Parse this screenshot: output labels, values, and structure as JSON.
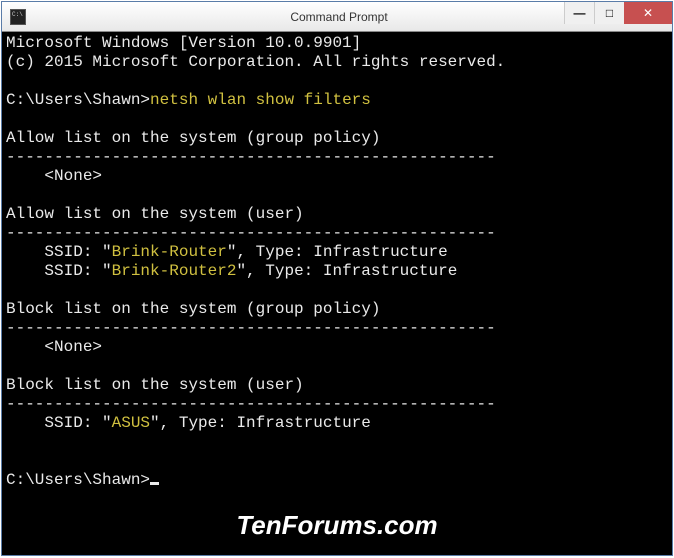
{
  "window": {
    "title": "Command Prompt",
    "min": "—",
    "max": "□",
    "close": "✕"
  },
  "terminal": {
    "line1": "Microsoft Windows [Version 10.0.9901]",
    "line2": "(c) 2015 Microsoft Corporation. All rights reserved.",
    "prompt1": "C:\\Users\\Shawn>",
    "command1": "netsh wlan show filters",
    "section1_title": "Allow list on the system (group policy)",
    "divider": "---------------------------------------------------",
    "none": "    <None>",
    "section2_title": "Allow list on the system (user)",
    "ssid_prefix": "    SSID: \"",
    "ssid1": "Brink-Router",
    "ssid2": "Brink-Router2",
    "ssid3": "ASUS",
    "ssid_suffix": "\", Type: Infrastructure",
    "section3_title": "Block list on the system (group policy)",
    "section4_title": "Block list on the system (user)",
    "prompt2": "C:\\Users\\Shawn>"
  },
  "watermark": "TenForums.com"
}
